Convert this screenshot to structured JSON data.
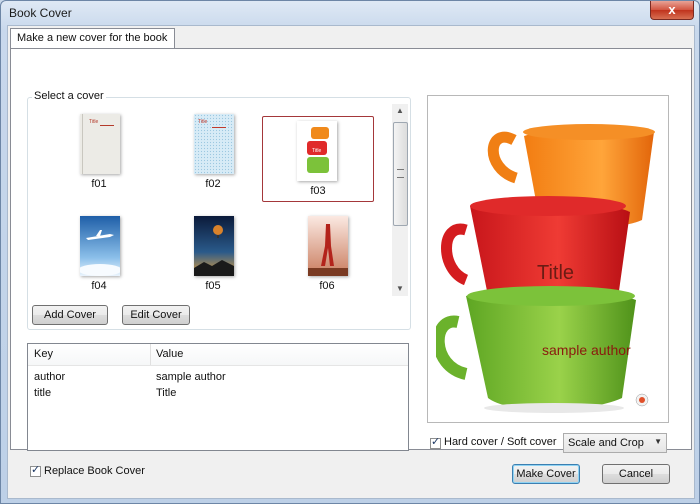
{
  "window": {
    "title": "Book Cover",
    "close_glyph": "x"
  },
  "tab": {
    "label": "Make a new cover for the book"
  },
  "select_cover": {
    "label": "Select a cover",
    "covers": [
      {
        "name": "f01",
        "thumb": "plain-gray"
      },
      {
        "name": "f02",
        "thumb": "light-blue"
      },
      {
        "name": "f03",
        "thumb": "cups",
        "selected": true
      },
      {
        "name": "f04",
        "thumb": "airplane"
      },
      {
        "name": "f05",
        "thumb": "night-balloon"
      },
      {
        "name": "f06",
        "thumb": "runner"
      }
    ],
    "thumb_text": {
      "f01_title": "Title",
      "f02_title": "Title",
      "f03_title": "Title"
    }
  },
  "buttons": {
    "add_cover": "Add Cover",
    "edit_cover": "Edit Cover",
    "make_cover": "Make Cover",
    "cancel": "Cancel"
  },
  "properties": {
    "headers": {
      "key": "Key",
      "value": "Value"
    },
    "rows": [
      {
        "key": "author",
        "value": "sample author"
      },
      {
        "key": "title",
        "value": "Title"
      }
    ]
  },
  "preview": {
    "title": "Title",
    "author": "sample author"
  },
  "options": {
    "hard_cover_label": "Hard cover / Soft cover",
    "hard_cover_checked": true,
    "scale_mode": "Scale and Crop"
  },
  "footer": {
    "replace_label": "Replace Book Cover",
    "replace_checked": true
  },
  "colors": {
    "selected_border": "#a4373a",
    "title_color": "#6b1c14"
  }
}
